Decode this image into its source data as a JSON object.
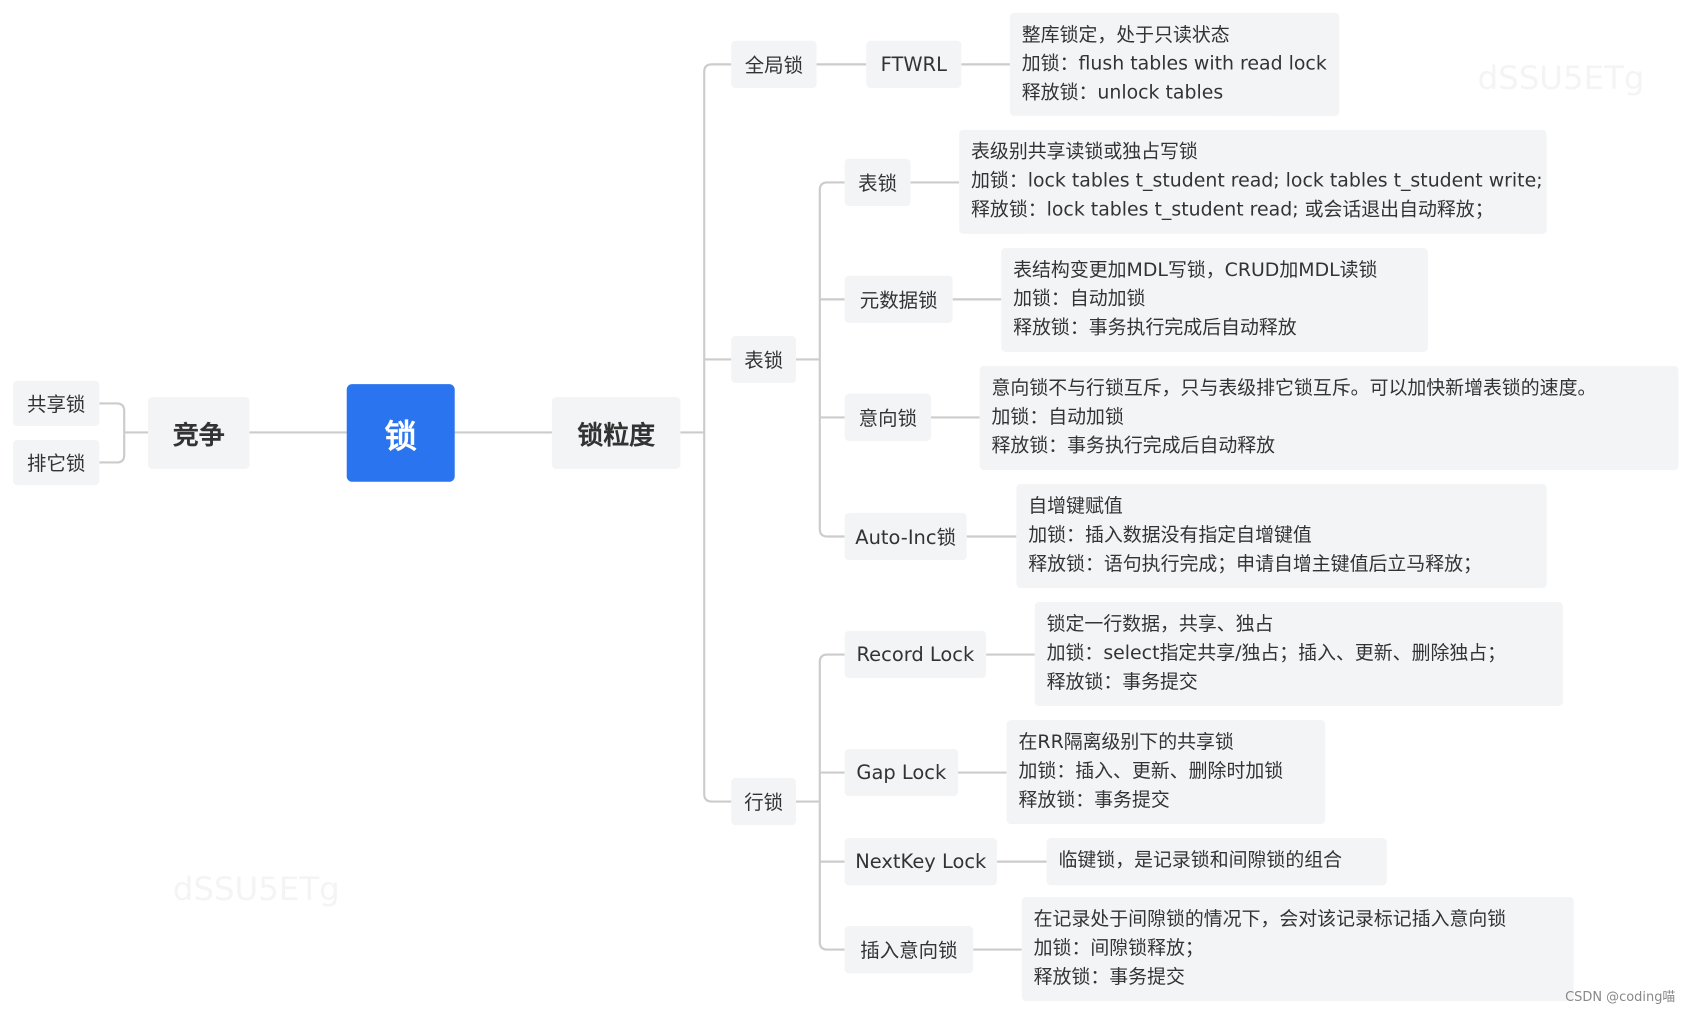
{
  "root": {
    "label": "锁"
  },
  "left": {
    "label": "竞争",
    "children": [
      "共享锁",
      "排它锁"
    ]
  },
  "right": {
    "label": "锁粒度"
  },
  "global": {
    "label": "全局锁",
    "child": "FTWRL",
    "desc": [
      "整库锁定，处于只读状态",
      "加锁：flush tables with read lock",
      "释放锁：unlock tables"
    ]
  },
  "table": {
    "label": "表锁",
    "items": [
      {
        "label": "表锁",
        "desc": [
          "表级别共享读锁或独占写锁",
          "加锁：lock tables t_student read; lock tables t_student write;",
          "释放锁：lock tables t_student read; 或会话退出自动释放；"
        ]
      },
      {
        "label": "元数据锁",
        "desc": [
          "表结构变更加MDL写锁，CRUD加MDL读锁",
          "加锁：自动加锁",
          "释放锁：事务执行完成后自动释放"
        ]
      },
      {
        "label": "意向锁",
        "desc": [
          "意向锁不与行锁互斥，只与表级排它锁互斥。可以加快新增表锁的速度。",
          "加锁：自动加锁",
          "释放锁：事务执行完成后自动释放"
        ]
      },
      {
        "label": "Auto-Inc锁",
        "desc": [
          "自增键赋值",
          "加锁：插入数据没有指定自增键值",
          "释放锁：语句执行完成；申请自增主键值后立马释放；"
        ]
      }
    ]
  },
  "row": {
    "label": "行锁",
    "items": [
      {
        "label": "Record Lock",
        "desc": [
          "锁定一行数据，共享、独占",
          "加锁：select指定共享/独占；插入、更新、删除独占；",
          "释放锁：事务提交"
        ]
      },
      {
        "label": "Gap Lock",
        "desc": [
          "在RR隔离级别下的共享锁",
          "加锁：插入、更新、删除时加锁",
          "释放锁：事务提交"
        ]
      },
      {
        "label": "NextKey Lock",
        "desc": [
          "临键锁，是记录锁和间隙锁的组合"
        ]
      },
      {
        "label": "插入意向锁",
        "desc": [
          "在记录处于间隙锁的情况下，会对该记录标记插入意向锁",
          "加锁：间隙锁释放；",
          "释放锁：事务提交"
        ]
      }
    ]
  },
  "watermark": "dSSU5ETg",
  "credit": "CSDN @coding喵",
  "colors": {
    "root": "#2b74ef",
    "node": "#f3f4f6",
    "line": "#cccccc"
  }
}
